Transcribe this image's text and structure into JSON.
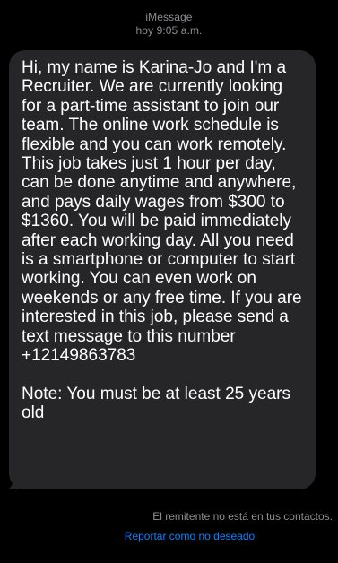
{
  "header": {
    "service": "iMessage",
    "timestamp": "hoy 9:05 a.m."
  },
  "message": {
    "text": "Hi, my name is Karina-Jo and I'm a Recruiter. We are currently looking for a part-time assistant to join our team. The online work schedule is flexible and you can work remotely. This job takes just 1 hour per day, can be done anytime and anywhere, and pays daily wages from $300 to $1360. You will be paid immediately after each working day. All you need is a smartphone or computer to start working. You can even work on weekends or any free time. If you are interested in this job, please send a text message to this number +12149863783\n\nNote: You must be at least 25 years old"
  },
  "footer": {
    "unknown_sender_note": "El remitente no está en tus contactos.",
    "report_label": "Reportar como no deseado"
  },
  "colors": {
    "background": "#000000",
    "bubble": "#262628",
    "secondary_text": "#8e8e93",
    "link": "#0a84ff"
  }
}
